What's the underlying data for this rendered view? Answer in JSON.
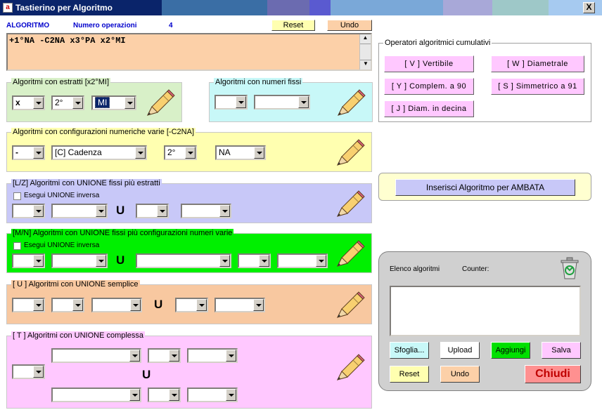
{
  "window": {
    "title": "Tastierino per Algoritmo",
    "close_label": "X"
  },
  "header": {
    "algoritmo_label": "ALGORITMO",
    "numero_label": "Numero operazioni",
    "numero_value": "4",
    "reset_label": "Reset",
    "undo_label": "Undo"
  },
  "expression": "+1°NA -C2NA x3°PA x2°MI",
  "estratti": {
    "legend": "Algoritmi con estratti  [x2°MI]",
    "op": "x",
    "pos": "2°",
    "ruota": "MI"
  },
  "fissi": {
    "legend": "Algoritmi con numeri fissi"
  },
  "config": {
    "legend": "Algoritmi con configurazioni numeriche varie  [-C2NA]",
    "op": "-",
    "conf": "[C] Cadenza",
    "pos": "2°",
    "ruota": "NA"
  },
  "lz": {
    "legend": "[L/Z] Algoritmi con UNIONE fissi più estratti",
    "check_label": "Esegui UNIONE inversa",
    "union": "U"
  },
  "mn": {
    "legend": "[M/N] Algoritmi con UNIONE fissi più configurazioni numeri varie",
    "check_label": "Esegui UNIONE inversa",
    "union": "U"
  },
  "u": {
    "legend": "[ U ] Algoritmi con UNIONE semplice",
    "union": "U"
  },
  "t": {
    "legend": "[ T ] Algoritmi con UNIONE complessa",
    "union": "U"
  },
  "cumulativi": {
    "legend": "Operatori algoritmici cumulativi",
    "buttons": [
      "[ V ] Vertibile",
      "[ W ] Diametrale",
      "[ Y ] Complem. a 90",
      "[ S ] Simmetrico  a 91",
      "[ J ] Diam. in decina"
    ]
  },
  "ambata": {
    "button": "Inserisci Algoritmo per AMBATA"
  },
  "elenco": {
    "label": "Elenco algoritmi",
    "counter_label": "Counter:",
    "sfoglia": "Sfoglia...",
    "upload": "Upload",
    "aggiungi": "Aggiungi",
    "salva": "Salva",
    "reset": "Reset",
    "undo": "Undo",
    "chiudi": "Chiudi"
  },
  "colors": {
    "title_blue": "#0a246a",
    "estratti_bg": "#d8f0c8",
    "fissi_bg": "#c8f8f8",
    "config_bg": "#ffffb0",
    "lz_bg": "#c8c8f8",
    "mn_bg": "#00f000",
    "u_bg": "#f8c8a0",
    "t_bg": "#ffc8ff",
    "expr_bg": "#fcd0a8",
    "elenco_bg": "#d0d0d0"
  }
}
